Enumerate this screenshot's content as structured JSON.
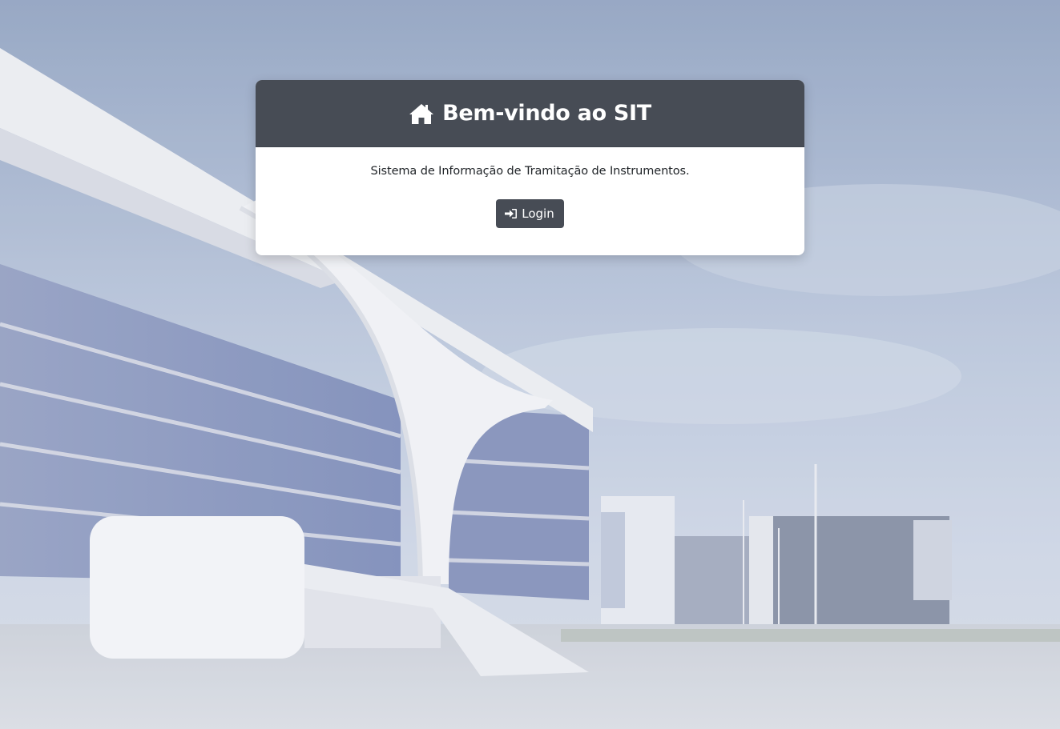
{
  "header": {
    "title": "Bem-vindo ao SIT",
    "icon": "home-icon"
  },
  "body": {
    "description": "Sistema de Informação de Tramitação de Instrumentos."
  },
  "login_button": {
    "label": "Login",
    "icon": "sign-in-icon"
  },
  "colors": {
    "header_bg": "#474c55",
    "button_bg": "#474c55",
    "card_bg": "#ffffff"
  }
}
